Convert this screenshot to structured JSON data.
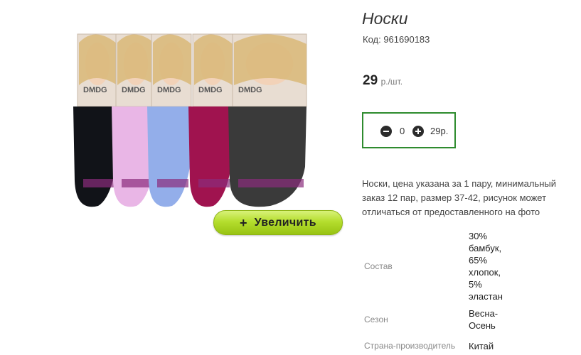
{
  "product": {
    "title": "Носки",
    "code": "Код: 961690183",
    "price": "29",
    "price_unit": "р./шт.",
    "zoom_label": "Увеличить",
    "zoom_plus": "+",
    "quantity": "0",
    "sum": "29р.",
    "description": "Носки, цена указана за 1 пару, минимальный заказ 12 пар, размер 37-42, рисунок может отличаться от предоставленного на фото",
    "properties": [
      {
        "key": "Состав",
        "value": "30% бамбук, 65% хлопок, 5% эластан"
      },
      {
        "key": "Сезон",
        "value": "Весна-Осень"
      },
      {
        "key": "Страна-производитель",
        "value": "Китай"
      }
    ]
  },
  "image": {
    "brand_label": "DMDG",
    "sock_colors": [
      "#111318",
      "#e9b6e6",
      "#93aeea",
      "#a0134f",
      "#3a3a3a"
    ]
  },
  "icons": {
    "minus": "minus-circle-icon",
    "plus": "plus-circle-icon"
  },
  "colors": {
    "qty_border": "#2e8b2e",
    "zoom_button": "#b5de2e"
  }
}
